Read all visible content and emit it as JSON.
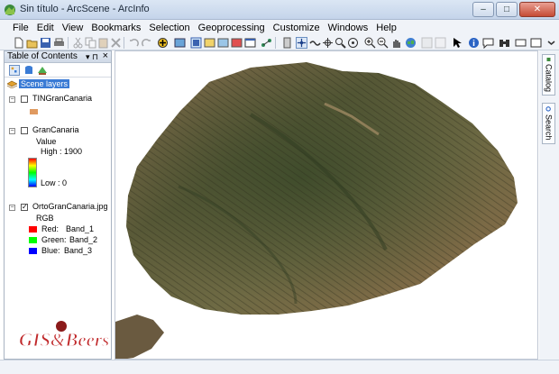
{
  "window": {
    "title": "Sin título - ArcScene - ArcInfo",
    "buttons": {
      "minimize": "–",
      "maximize": "□",
      "close": "✕"
    }
  },
  "menu": [
    "File",
    "Edit",
    "View",
    "Bookmarks",
    "Selection",
    "Geoprocessing",
    "Customize",
    "Windows",
    "Help"
  ],
  "toc": {
    "title": "Table of Contents",
    "pin_glyph": "▾ ⊓",
    "close_glyph": "×",
    "scene_layers": "Scene layers",
    "layers": [
      {
        "name": "TINGranCanaria",
        "checked": false,
        "swatch_color": "#e09a60"
      },
      {
        "name": "GranCanaria",
        "checked": false,
        "field": "Value",
        "high": "High : 1900",
        "low": "Low : 0"
      },
      {
        "name": "OrtoGranCanaria.jpg",
        "checked": true,
        "field": "RGB",
        "bands": [
          {
            "label": "Red:",
            "band": "Band_1",
            "color": "#ff0000"
          },
          {
            "label": "Green:",
            "band": "Band_2",
            "color": "#00ff00"
          },
          {
            "label": "Blue:",
            "band": "Band_3",
            "color": "#0000ff"
          }
        ]
      }
    ]
  },
  "dock": {
    "catalog": "Catalog",
    "search": "Search"
  },
  "watermark": {
    "text": "GIS&Beers"
  },
  "colors": {
    "accent": "#3a7bd5",
    "watermark": "#c0282a"
  }
}
